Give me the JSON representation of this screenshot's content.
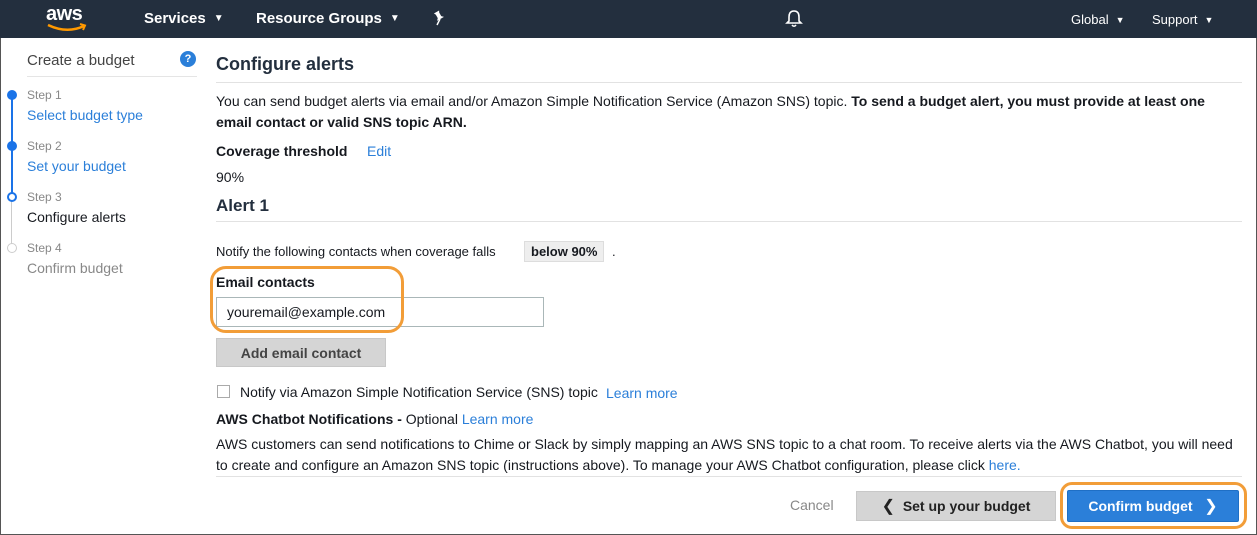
{
  "topnav": {
    "logo": "aws",
    "services": "Services",
    "resource_groups": "Resource Groups",
    "global": "Global",
    "support": "Support"
  },
  "sidebar": {
    "title": "Create a budget",
    "help": "?",
    "steps": [
      {
        "num": "Step 1",
        "label": "Select budget type"
      },
      {
        "num": "Step 2",
        "label": "Set your budget"
      },
      {
        "num": "Step 3",
        "label": "Configure alerts"
      },
      {
        "num": "Step 4",
        "label": "Confirm budget"
      }
    ]
  },
  "main": {
    "title": "Configure alerts",
    "intro_plain": "You can send budget alerts via email and/or Amazon Simple Notification Service (Amazon SNS) topic. ",
    "intro_bold": "To send a budget alert, you must provide at least one email contact or valid SNS topic ARN.",
    "coverage_label": "Coverage threshold",
    "coverage_edit": "Edit",
    "coverage_value": "90%",
    "alert_title": "Alert 1",
    "notify_text": "Notify the following contacts when coverage falls",
    "notify_badge": "below 90%",
    "notify_end": ".",
    "email_label": "Email contacts",
    "email_value": "youremail@example.com",
    "add_email_button": "Add email contact",
    "sns_checkbox_label": "Notify via Amazon Simple Notification Service (SNS) topic",
    "learn_more": "Learn more",
    "chatbot_title": "AWS Chatbot Notifications -",
    "chatbot_optional": " Optional ",
    "chatbot_learn_more": "Learn more",
    "chatbot_para": "AWS customers can send notifications to Chime or Slack by simply mapping an AWS SNS topic to a chat room. To receive alerts via the AWS Chatbot, you will need to create and configure an Amazon SNS topic (instructions above). To manage your AWS Chatbot configuration, please click ",
    "chatbot_here": "here."
  },
  "footer": {
    "cancel": "Cancel",
    "back_button": "Set up your budget",
    "confirm_button": "Confirm budget"
  },
  "colors": {
    "nav_bg": "#232f3e",
    "link": "#2b7fd9",
    "primary_button": "#2b7fd9",
    "highlight": "#f29d38"
  }
}
